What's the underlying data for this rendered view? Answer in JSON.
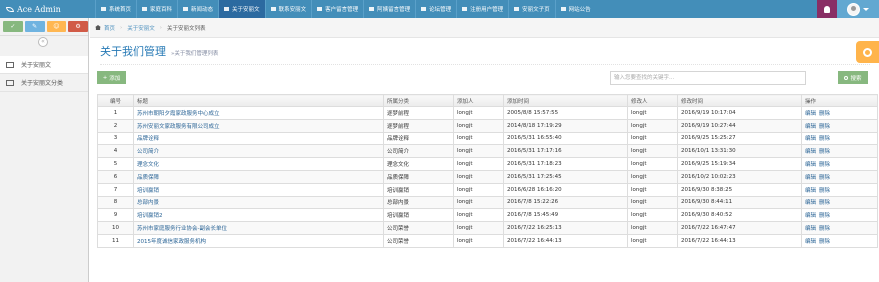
{
  "app": {
    "title": "Ace Admin"
  },
  "nav": {
    "items": [
      {
        "label": "系统首页",
        "active": false
      },
      {
        "label": "家庭百科",
        "active": false
      },
      {
        "label": "新闻动态",
        "active": false
      },
      {
        "label": "关于安丽文",
        "active": true
      },
      {
        "label": "联系安丽文",
        "active": false
      },
      {
        "label": "客户留言管理",
        "active": false
      },
      {
        "label": "阿姨留言管理",
        "active": false
      },
      {
        "label": "论坛管理",
        "active": false
      },
      {
        "label": "注册用户管理",
        "active": false
      },
      {
        "label": "安丽文子页",
        "active": false
      },
      {
        "label": "网站公告",
        "active": false
      }
    ]
  },
  "sidebar": {
    "shortcuts": [
      "✓",
      "✎",
      "☺",
      "⚙"
    ],
    "collapse_label": "«",
    "items": [
      {
        "label": "关于安丽文"
      },
      {
        "label": "关于安丽文分类"
      }
    ]
  },
  "breadcrumb": {
    "home": "首页",
    "parent": "关于安丽文",
    "current": "关于安丽文列表"
  },
  "page": {
    "title": "关于我们管理",
    "subtitle": "»关于我们管理列表"
  },
  "toolbar": {
    "add_label": "添加",
    "add_icon": "+",
    "search_placeholder": "输入您要查找的关键字...",
    "search_label": "搜索"
  },
  "table": {
    "headers": [
      "编号",
      "标题",
      "所属分类",
      "添加人",
      "添加时间",
      "修改人",
      "修改时间",
      "操作"
    ],
    "ops": {
      "edit": "编辑",
      "delete": "删除"
    },
    "rows": [
      {
        "id": "1",
        "title": "苏州市朝阳夕霞家政服务中心成立",
        "category": "逐梦前程",
        "adder": "longjt",
        "added": "2005/8/8 15:57:55",
        "modifier": "longjt",
        "modified": "2016/9/19 10:17:04"
      },
      {
        "id": "2",
        "title": "苏州安丽文家政服务有限公司成立",
        "category": "逐梦前程",
        "adder": "longjt",
        "added": "2014/8/18 17:19:29",
        "modifier": "longjt",
        "modified": "2016/9/19 10:27:44"
      },
      {
        "id": "3",
        "title": "品牌诠释",
        "category": "品牌诠释",
        "adder": "longjt",
        "added": "2016/5/31 16:55:40",
        "modifier": "longjt",
        "modified": "2016/9/25 15:25:27"
      },
      {
        "id": "4",
        "title": "公司简介",
        "category": "公司简介",
        "adder": "longjt",
        "added": "2016/5/31 17:17:16",
        "modifier": "longjt",
        "modified": "2016/10/1 13:31:30"
      },
      {
        "id": "5",
        "title": "理念文化",
        "category": "理念文化",
        "adder": "longjt",
        "added": "2016/5/31 17:18:23",
        "modifier": "longjt",
        "modified": "2016/9/25 15:19:34"
      },
      {
        "id": "6",
        "title": "品质保障",
        "category": "品质保障",
        "adder": "longjt",
        "added": "2016/5/31 17:25:45",
        "modifier": "longjt",
        "modified": "2016/10/2 10:02:23"
      },
      {
        "id": "7",
        "title": "培训赢销",
        "category": "培训赢销",
        "adder": "longjt",
        "added": "2016/6/28 16:16:20",
        "modifier": "longjt",
        "modified": "2016/9/30 8:38:25"
      },
      {
        "id": "8",
        "title": "总部内景",
        "category": "总部内景",
        "adder": "longjt",
        "added": "2016/7/8 15:22:26",
        "modifier": "longjt",
        "modified": "2016/9/30 8:44:11"
      },
      {
        "id": "9",
        "title": "培训赢销2",
        "category": "培训赢销",
        "adder": "longjt",
        "added": "2016/7/8 15:45:49",
        "modifier": "longjt",
        "modified": "2016/9/30 8:40:52"
      },
      {
        "id": "10",
        "title": "苏州市家庭服务行业协会-副会长单位",
        "category": "公司荣誉",
        "adder": "longjt",
        "added": "2016/7/22 16:25:13",
        "modifier": "longjt",
        "modified": "2016/7/22 16:47:47"
      },
      {
        "id": "11",
        "title": "2015年度诚信家政服务机构",
        "category": "公司荣誉",
        "adder": "longjt",
        "added": "2016/7/22 16:44:13",
        "modifier": "longjt",
        "modified": "2016/7/22 16:44:13"
      }
    ]
  },
  "colors": {
    "navbar": "#438eb9",
    "nav_active": "#2c6aa0",
    "accent_green": "#87b87f",
    "title_blue": "#2679b5",
    "link": "#2a6496",
    "bell": "#892e65",
    "settings": "#ffb44b"
  },
  "icons": {
    "home": "home-icon",
    "bell": "bell-icon",
    "gear": "gear-icon",
    "search": "search-icon",
    "add": "plus-icon"
  }
}
